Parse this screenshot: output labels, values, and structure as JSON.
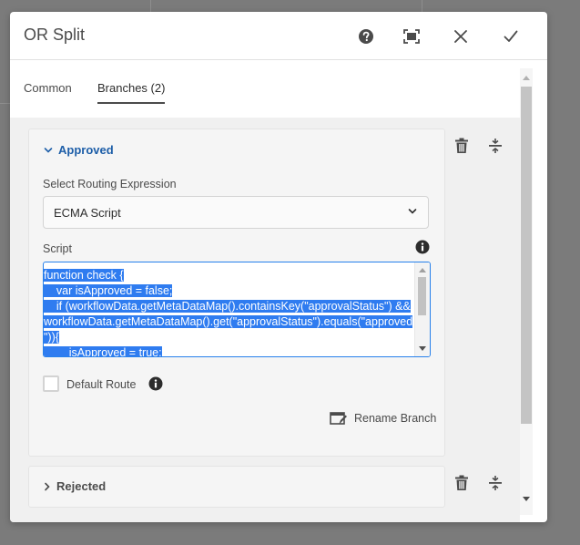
{
  "dialog": {
    "title": "OR Split",
    "actions": {
      "help": "help-icon",
      "fullscreen": "fullscreen-icon",
      "close": "close-icon",
      "done": "check-icon"
    }
  },
  "tabs": [
    {
      "label": "Common",
      "active": false
    },
    {
      "label": "Branches (2)",
      "active": true
    }
  ],
  "branch1": {
    "name": "Approved",
    "expanded": true,
    "routing_label": "Select Routing Expression",
    "routing_value": "ECMA Script",
    "script_label": "Script",
    "script_lines": [
      "function check {",
      "    var isApproved = false;",
      "    if (workflowData.getMetaDataMap().containsKey(\"approvalStatus\") &&",
      "workflowData.getMetaDataMap().get(\"approvalStatus\").equals(\"approved",
      "\")){",
      "        isApproved = true;"
    ],
    "default_route_label": "Default Route",
    "default_route_checked": false,
    "rename_label": "Rename Branch"
  },
  "branch2": {
    "name": "Rejected",
    "expanded": false
  },
  "colors": {
    "accent": "#2680eb",
    "selection": "#2f7cf0",
    "section_title": "#1d5ea8"
  }
}
